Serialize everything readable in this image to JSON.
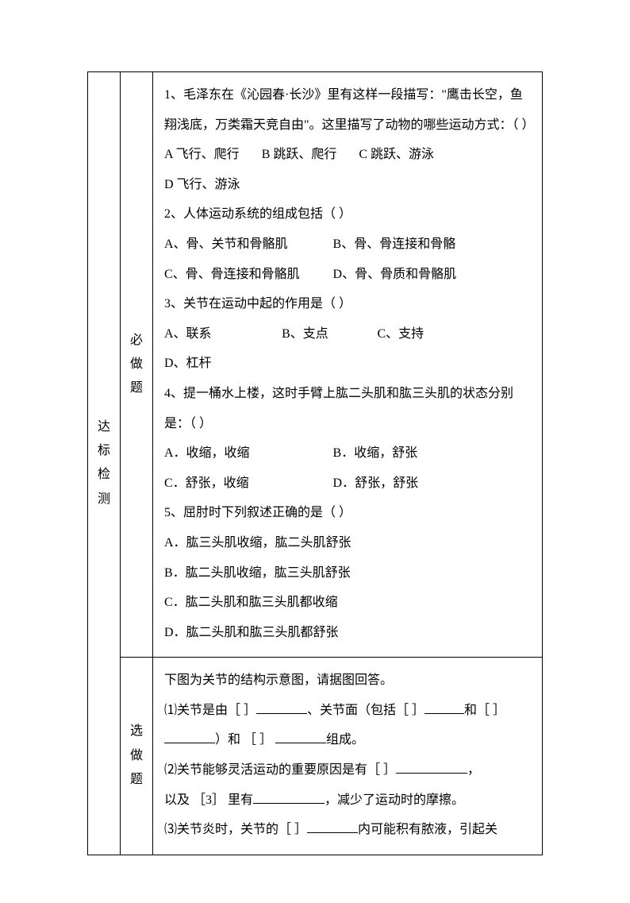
{
  "sectionLabel": "达标检测",
  "mandatoryLabel": "必做题",
  "optionalLabel": "选做题",
  "q1": {
    "stem": "1、毛泽东在《沁园春·长沙》里有这样一段描写：\"鹰击长空，鱼翔浅底，万类霜天竞自由\"。这里描写了动物的哪些运动方式：（      ）",
    "optA": "A 飞行、爬行",
    "optB": "B 跳跃、爬行",
    "optC": "C 跳跃、游泳",
    "optD": "D 飞行、游泳"
  },
  "q2": {
    "stem": "2、人体运动系统的组成包括（          ）",
    "optA": "A、骨、关节和骨骼肌",
    "optB": "B、骨、骨连接和骨骼",
    "optC": "C、骨、骨连接和骨骼肌",
    "optD": "D、骨、骨质和骨骼肌"
  },
  "q3": {
    "stem": "3、关节在运动中起的作用是（       ）",
    "optA": "A、联系",
    "optB": "B、支点",
    "optC": "C、支持",
    "optD": "D、杠杆"
  },
  "q4": {
    "stem": "4、提一桶水上楼，这时手臂上肱二头肌和肱三头肌的状态分别是：（     ）",
    "optA": "A．收缩，收缩",
    "optB": "B．收缩，舒张",
    "optC": "C．舒张，收缩",
    "optD": "D．舒张，舒张"
  },
  "q5": {
    "stem": "5、屈肘时下列叙述正确的是（     ）",
    "optA": "A．肱三头肌收缩，肱二头肌舒张",
    "optB": "B．肱二头肌收缩，肱三头肌舒张",
    "optC": "C．肱二头肌和肱三头肌都收缩",
    "optD": "D．肱二头肌和肱三头肌都舒张"
  },
  "opt": {
    "intro": "下图为关节的结构示意图，请据图回答。",
    "p1a": "⑴关节是由［  ］",
    "p1b": "、关节面（包括［  ］",
    "p1c": "和［  ］",
    "p1d": "）和 ［  ］ ",
    "p1e": "组成。",
    "p2a": "⑵关节能够灵活运动的重要原因是有［  ］",
    "p2b": "，",
    "p2c": "  以及 ［3］ 里有",
    "p2d": "，减少了运动时的摩擦。",
    "p3a": "⑶关节炎时，关节的［  ］",
    "p3b": "内可能积有脓液，引起关"
  }
}
